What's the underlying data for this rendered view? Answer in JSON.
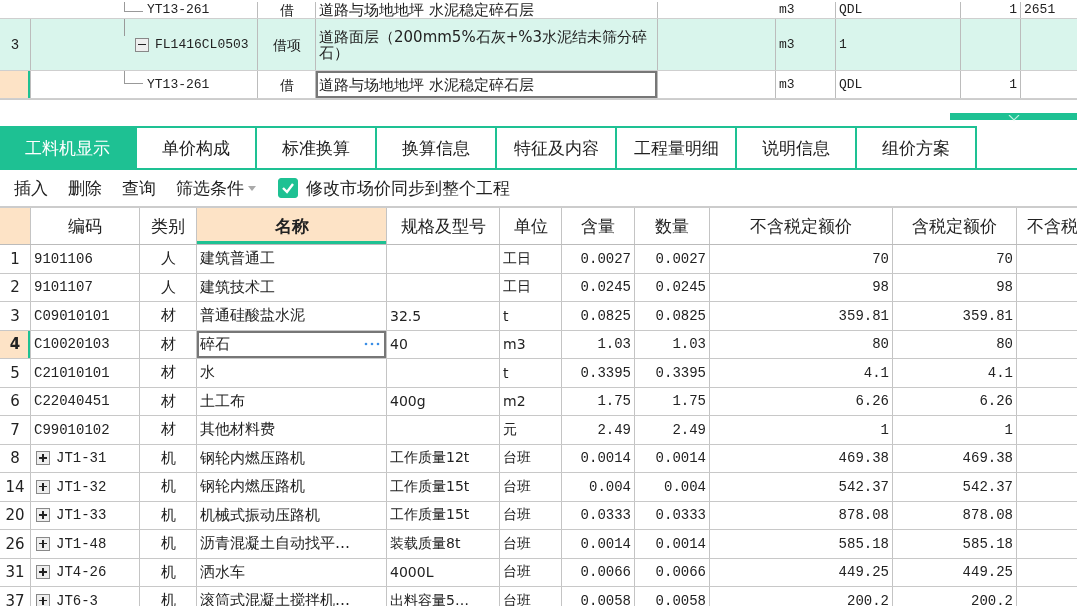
{
  "upper_table": {
    "rows": [
      {
        "index": "",
        "code": "YT13-261",
        "kind": "child",
        "type": "借",
        "name": "道路与场地地坪 水泥稳定碎石层",
        "unit": "m3",
        "column_6": "QDL",
        "column_7": "1",
        "column_8": "2651",
        "selected": false
      },
      {
        "index": "3",
        "code": "FL1416CL0503",
        "kind": "parent",
        "expanded": true,
        "type": "借项",
        "name": "道路面层（200mm5%石灰+%3水泥结未筛分碎石）",
        "unit": "m3",
        "column_6": "1",
        "column_7": "",
        "column_8": "",
        "selected": false
      },
      {
        "index": "",
        "code": "YT13-261",
        "kind": "child",
        "type": "借",
        "name": "道路与场地地坪 水泥稳定碎石层",
        "unit": "m3",
        "column_6": "QDL",
        "column_7": "1",
        "column_8": "",
        "selected": true
      }
    ]
  },
  "tabs": [
    {
      "label": "工料机显示",
      "selected": true
    },
    {
      "label": "单价构成",
      "selected": false
    },
    {
      "label": "标准换算",
      "selected": false
    },
    {
      "label": "换算信息",
      "selected": false
    },
    {
      "label": "特征及内容",
      "selected": false
    },
    {
      "label": "工程量明细",
      "selected": false
    },
    {
      "label": "说明信息",
      "selected": false
    },
    {
      "label": "组价方案",
      "selected": false
    }
  ],
  "toolbar": {
    "buttons": [
      {
        "label": "插入",
        "dropdown": false
      },
      {
        "label": "删除",
        "dropdown": false
      },
      {
        "label": "查询",
        "dropdown": false
      },
      {
        "label": "筛选条件",
        "dropdown": true
      }
    ],
    "sync_checkbox": {
      "label": "修改市场价同步到整个工程",
      "checked": true
    }
  },
  "table": {
    "columns": [
      {
        "label": "编码",
        "sorted": false
      },
      {
        "label": "类别",
        "sorted": false
      },
      {
        "label": "名称",
        "sorted": true
      },
      {
        "label": "规格及型号",
        "sorted": false
      },
      {
        "label": "单位",
        "sorted": false
      },
      {
        "label": "含量",
        "sorted": false
      },
      {
        "label": "数量",
        "sorted": false
      },
      {
        "label": "不含税定额价",
        "sorted": false
      },
      {
        "label": "含税定额价",
        "sorted": false
      },
      {
        "label": "不含税",
        "sorted": false
      }
    ],
    "rows": [
      {
        "index": "1",
        "kind": "item",
        "code": "9101106",
        "type": "人",
        "name": "建筑普通工",
        "spec": "",
        "unit": "工日",
        "content": "0.0027",
        "quantity": "0.0027",
        "price_ex_tax": "70",
        "price_inc_tax": "70",
        "selected": false
      },
      {
        "index": "2",
        "kind": "item",
        "code": "9101107",
        "type": "人",
        "name": "建筑技术工",
        "spec": "",
        "unit": "工日",
        "content": "0.0245",
        "quantity": "0.0245",
        "price_ex_tax": "98",
        "price_inc_tax": "98",
        "selected": false
      },
      {
        "index": "3",
        "kind": "item",
        "code": "C09010101",
        "type": "材",
        "name": "普通硅酸盐水泥",
        "spec": "32.5",
        "unit": "t",
        "content": "0.0825",
        "quantity": "0.0825",
        "price_ex_tax": "359.81",
        "price_inc_tax": "359.81",
        "selected": false
      },
      {
        "index": "4",
        "kind": "item",
        "code": "C10020103",
        "type": "材",
        "name": "碎石",
        "spec": "40",
        "unit": "m3",
        "content": "1.03",
        "quantity": "1.03",
        "price_ex_tax": "80",
        "price_inc_tax": "80",
        "selected": true
      },
      {
        "index": "5",
        "kind": "item",
        "code": "C21010101",
        "type": "材",
        "name": "水",
        "spec": "",
        "unit": "t",
        "content": "0.3395",
        "quantity": "0.3395",
        "price_ex_tax": "4.1",
        "price_inc_tax": "4.1",
        "selected": false
      },
      {
        "index": "6",
        "kind": "item",
        "code": "C22040451",
        "type": "材",
        "name": "土工布",
        "spec": "400g",
        "unit": "m2",
        "content": "1.75",
        "quantity": "1.75",
        "price_ex_tax": "6.26",
        "price_inc_tax": "6.26",
        "selected": false
      },
      {
        "index": "7",
        "kind": "item",
        "code": "C99010102",
        "type": "材",
        "name": "其他材料费",
        "spec": "",
        "unit": "元",
        "content": "2.49",
        "quantity": "2.49",
        "price_ex_tax": "1",
        "price_inc_tax": "1",
        "selected": false
      },
      {
        "index": "8",
        "kind": "group",
        "code": "JT1-31",
        "type": "机",
        "name": "钢轮内燃压路机",
        "spec": "工作质量12t",
        "unit": "台班",
        "content": "0.0014",
        "quantity": "0.0014",
        "price_ex_tax": "469.38",
        "price_inc_tax": "469.38",
        "selected": false
      },
      {
        "index": "14",
        "kind": "group",
        "code": "JT1-32",
        "type": "机",
        "name": "钢轮内燃压路机",
        "spec": "工作质量15t",
        "unit": "台班",
        "content": "0.004",
        "quantity": "0.004",
        "price_ex_tax": "542.37",
        "price_inc_tax": "542.37",
        "selected": false
      },
      {
        "index": "20",
        "kind": "group",
        "code": "JT1-33",
        "type": "机",
        "name": "机械式振动压路机",
        "spec": "工作质量15t",
        "unit": "台班",
        "content": "0.0333",
        "quantity": "0.0333",
        "price_ex_tax": "878.08",
        "price_inc_tax": "878.08",
        "selected": false
      },
      {
        "index": "26",
        "kind": "group",
        "code": "JT1-48",
        "type": "机",
        "name": "沥青混凝土自动找平…",
        "spec": "装载质量8t",
        "unit": "台班",
        "content": "0.0014",
        "quantity": "0.0014",
        "price_ex_tax": "585.18",
        "price_inc_tax": "585.18",
        "selected": false
      },
      {
        "index": "31",
        "kind": "group",
        "code": "JT4-26",
        "type": "机",
        "name": "洒水车",
        "spec": "4000L",
        "unit": "台班",
        "content": "0.0066",
        "quantity": "0.0066",
        "price_ex_tax": "449.25",
        "price_inc_tax": "449.25",
        "selected": false
      },
      {
        "index": "37",
        "kind": "group",
        "code": "JT6-3",
        "type": "机",
        "name": "滚筒式混凝土搅拌机…",
        "spec": "出料容量5…",
        "unit": "台班",
        "content": "0.0058",
        "quantity": "0.0058",
        "price_ex_tax": "200.2",
        "price_inc_tax": "200.2",
        "selected": false
      }
    ]
  }
}
